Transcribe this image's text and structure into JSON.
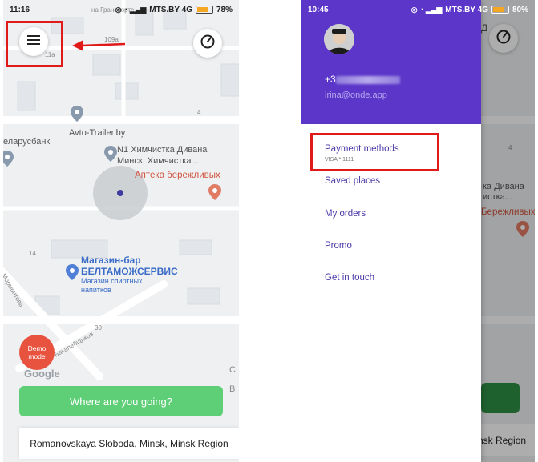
{
  "left_screen": {
    "status": {
      "time": "11:16",
      "carrier": "MTS.BY 4G",
      "battery": "78%",
      "battery_level": 0.78
    },
    "top_street_partial": "на Гранспорте",
    "menu_icon": "hamburger-menu-icon",
    "locate_icon": "compass-icon",
    "map_labels": {
      "house_109a": "109a",
      "house_11a": "11a",
      "house_4": "4",
      "house_14": "14",
      "road_30": "30",
      "street_vertical": "Мормонтова",
      "street_diag": "Бакалейщиков",
      "avto_trailer": "Avto-Trailer.by",
      "belarusbank": "еларусбанк",
      "himchistka_1": "N1 Химчистка Дивана",
      "himchistka_2": "Минск, Химчистка...",
      "apteka": "Аптека бережливых",
      "shop_1": "Магазин-бар",
      "shop_2": "БЕЛТАМОЖСЕРВИС",
      "shop_3": "Магазин спиртных",
      "shop_4": "напитков",
      "right_edge_partial_1": "С",
      "right_edge_partial_2": "В"
    },
    "demo_badge": "Demo mode",
    "google_logo": "Google",
    "where_button": "Where are you going?",
    "address": "Romanovskaya Sloboda, Minsk, Minsk Region",
    "highlight_color": "#e01919",
    "accent_green": "#5fcf77"
  },
  "right_screen": {
    "status": {
      "time": "10:45",
      "carrier": "MTS.BY 4G",
      "battery": "80%",
      "battery_level": 0.8
    },
    "drawer": {
      "phone_prefix": "+3",
      "email": "irina@onde.app",
      "items": [
        {
          "label": "Payment methods",
          "sub": "VISA * 1111"
        },
        {
          "label": "Saved places"
        },
        {
          "label": "My orders"
        },
        {
          "label": "Promo"
        },
        {
          "label": "Get in touch"
        }
      ],
      "header_color": "#5b36c9"
    },
    "behind_map": {
      "partial_top": "Д",
      "house_4": "4",
      "l1": "ка Дивана",
      "l2": "истка...",
      "l3": "Бережливых",
      "address_partial": "nsk Region"
    },
    "locate_icon": "compass-icon"
  }
}
